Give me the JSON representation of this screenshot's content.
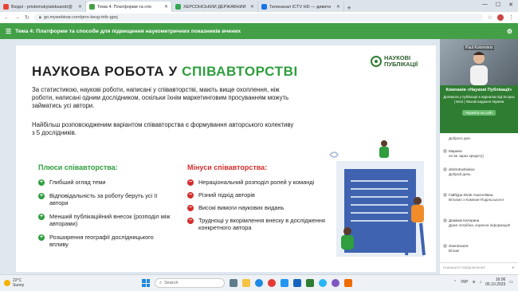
{
  "browser": {
    "tabs": [
      {
        "title": "Вхідні - pristemskyialeksandr@",
        "favicon_color": "#ea4335",
        "active": false
      },
      {
        "title": "Тема 4: Платформи та спо",
        "favicon_color": "#43a047",
        "active": true
      },
      {
        "title": "ХЕРСОНСЬКИЙ ДЕРЖАВНИЙ",
        "favicon_color": "#34a853",
        "active": false
      },
      {
        "title": "Телеканал ICTV HD — дивити",
        "favicon_color": "#1a73e8",
        "active": false
      }
    ],
    "new_tab": "+",
    "url": "go.mywebinar.com/prrs-kevg-tnfz-gpxj"
  },
  "webinar": {
    "title": "Тема 4: Платформи та способи для підвищення наукометричних показників вчених"
  },
  "slide": {
    "logo_line1": "НАУКОВІ",
    "logo_line2": "ПУБЛІКАЦІЇ",
    "title_plain": "НАУКОВА РОБОТА У ",
    "title_highlight": "СПІВАВТОРСТВІ",
    "paragraph1": "За статистикою, наукові роботи, написані у співавторстві, мають вище охоплення, ніж роботи, написані одним дослідником, оскільки їхнім маркетинговим просуванням можуть займатись усі автори.",
    "paragraph2": "Найбільш розповсюдженим варіантом співавторства є формування авторського колективу з 5 дослідників.",
    "pros_title": "Плюси співавторства:",
    "pros": [
      "Глибший огляд теми",
      "Відповідальність за роботу беруть усі її автори",
      "Менший публікаційний внесок (розподіл між авторами)",
      "Розширення географії дослідницького впливу"
    ],
    "cons_title": "Мінуси співавторства:",
    "cons": [
      "Нераціональний розподіл ролей у команді",
      "Різний підхід авторів",
      "Високі вимоги наукових видань",
      "Труднощі у вкорімлення внеску в дослідження конкретного автора"
    ]
  },
  "chat": {
    "presenter_name": "Paul Kolomiiets",
    "promo_title": "Компанія «Наукові Публікації»",
    "promo_desc": "Допомога у публікації в журналах БД Scopus | WoS | Фахові видання України",
    "promo_button": "Перейти на сайт",
    "messages": [
      {
        "author": "",
        "text": "Доброго дня."
      },
      {
        "author": "Марина",
        "text": "не ве зараз кредиту)"
      },
      {
        "author": "dmitrotrushakov",
        "text": "Доброй день."
      },
      {
        "author": "Гайбура Юлія Анатоліївна",
        "text": "Вітаємо з Компані-Подільського!"
      },
      {
        "author": "Доміник Катерина",
        "text": "Дуже потрібна, корисна інформація!"
      },
      {
        "author": "vlsentova15",
        "text": "Вітаю!"
      }
    ],
    "input_placeholder": "Напишите повідомлення"
  },
  "taskbar": {
    "weather_temp": "22°C",
    "weather_desc": "Sunny",
    "search_placeholder": "Search",
    "language": "УКР",
    "time": "16:06",
    "date": "05.10.2023"
  }
}
